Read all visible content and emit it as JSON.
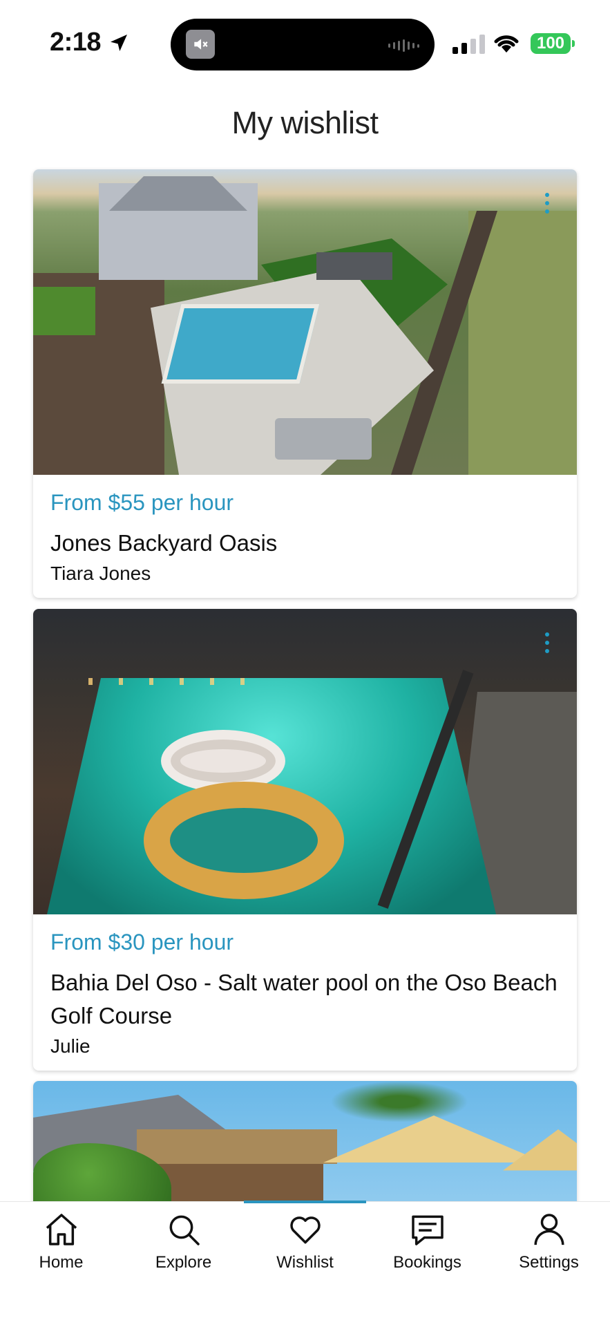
{
  "status_bar": {
    "time": "2:18",
    "battery": "100"
  },
  "page": {
    "title": "My wishlist"
  },
  "listings": [
    {
      "price": "From $55 per hour",
      "name": "Jones Backyard Oasis",
      "host": "Tiara Jones"
    },
    {
      "price": "From $30 per hour",
      "name": "Bahia Del Oso - Salt water pool on the Oso Beach Golf Course",
      "host": "Julie"
    },
    {
      "price": "",
      "name": "",
      "host": ""
    }
  ],
  "tab_bar": {
    "active": "Wishlist",
    "tabs": [
      {
        "label": "Home",
        "icon": "home-icon"
      },
      {
        "label": "Explore",
        "icon": "search-icon"
      },
      {
        "label": "Wishlist",
        "icon": "heart-icon"
      },
      {
        "label": "Bookings",
        "icon": "chat-icon"
      },
      {
        "label": "Settings",
        "icon": "person-icon"
      }
    ]
  },
  "colors": {
    "accent": "#2a95bf",
    "battery": "#34c759"
  }
}
